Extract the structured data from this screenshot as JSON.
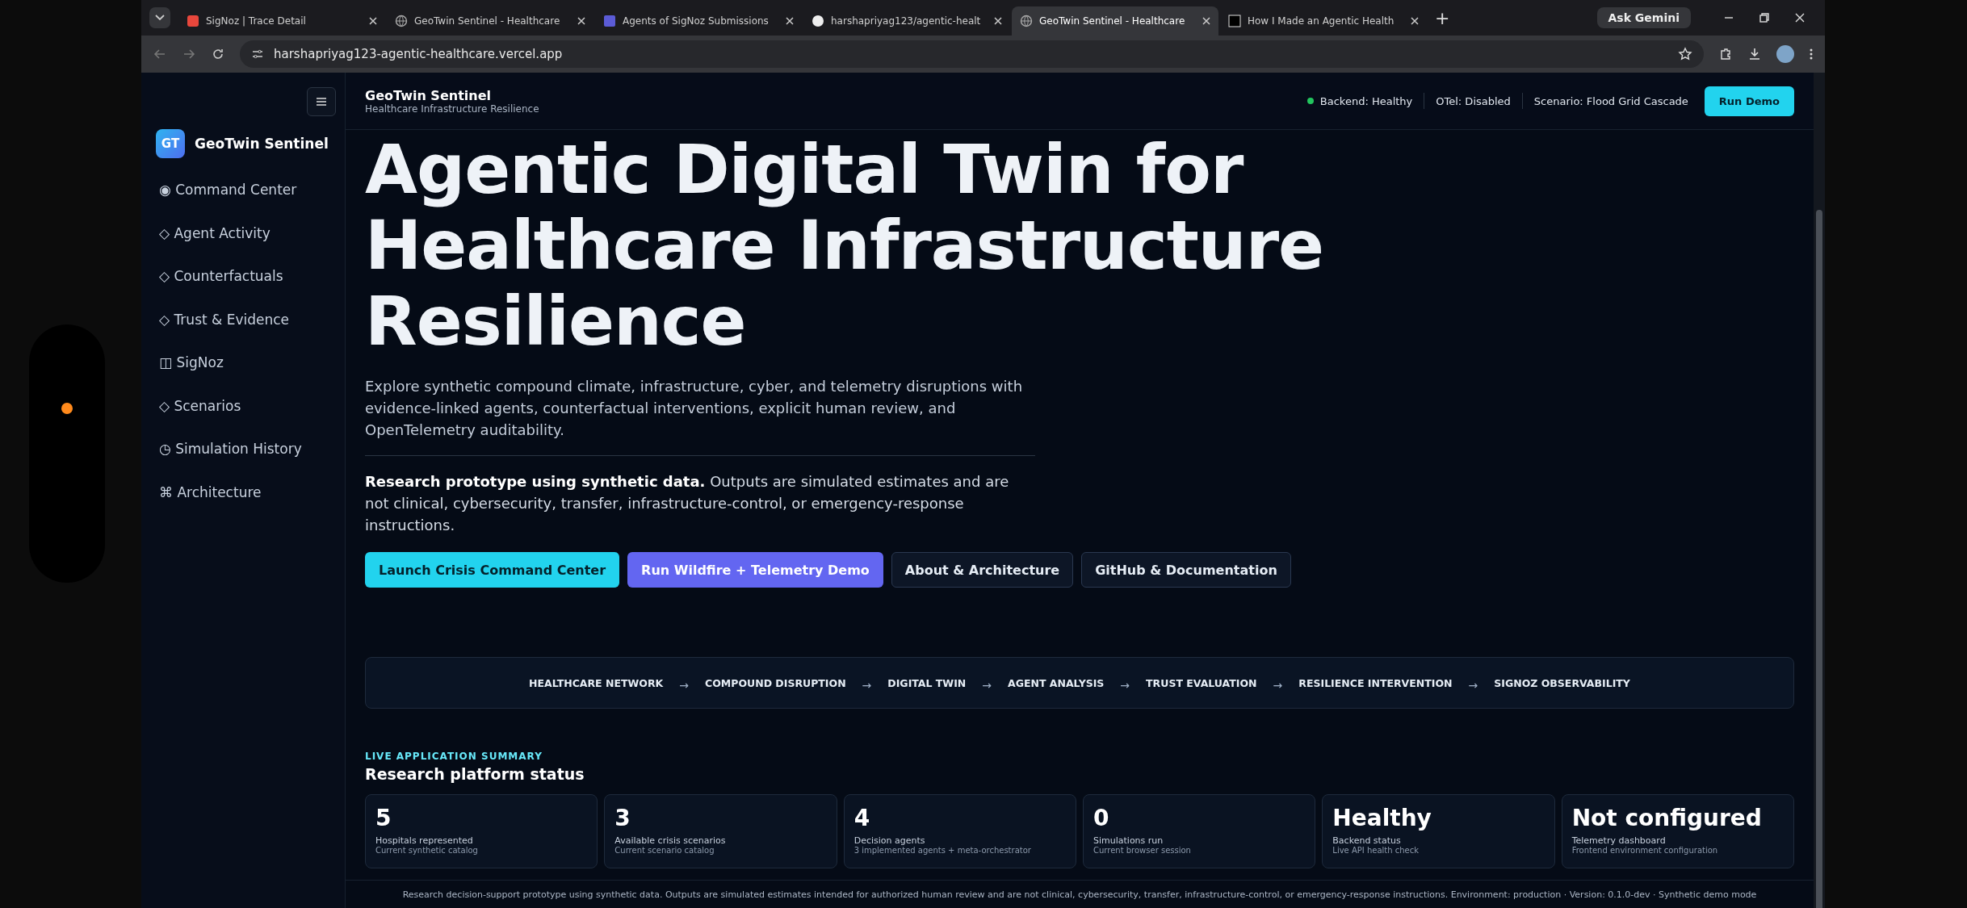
{
  "browser": {
    "tabs": [
      {
        "title": "SigNoz | Trace Detail",
        "selected": false
      },
      {
        "title": "GeoTwin Sentinel - Healthcare",
        "selected": false
      },
      {
        "title": "Agents of SigNoz Submissions",
        "selected": false
      },
      {
        "title": "harshapriyag123/agentic-healt",
        "selected": false
      },
      {
        "title": "GeoTwin Sentinel - Healthcare",
        "selected": true
      },
      {
        "title": "How I Made an Agentic Health",
        "selected": false
      }
    ],
    "new_tab": "+",
    "ask_button": "Ask Gemini",
    "address": "harshapriyag123-agentic-healthcare.vercel.app"
  },
  "sidebar": {
    "logo": "GT",
    "title": "GeoTwin Sentinel",
    "items": [
      {
        "icon": "◉",
        "label": "Command Center"
      },
      {
        "icon": "◇",
        "label": "Agent Activity"
      },
      {
        "icon": "◇",
        "label": "Counterfactuals"
      },
      {
        "icon": "◇",
        "label": "Trust & Evidence"
      },
      {
        "icon": "◫",
        "label": "SigNoz"
      },
      {
        "icon": "◇",
        "label": "Scenarios"
      },
      {
        "icon": "◷",
        "label": "Simulation History"
      },
      {
        "icon": "⌘",
        "label": "Architecture"
      }
    ]
  },
  "header": {
    "title": "GeoTwin Sentinel",
    "subtitle": "Healthcare Infrastructure Resilience",
    "statuses": [
      {
        "label": "Backend: Healthy",
        "color": "#22c55e"
      },
      {
        "label": "OTel: Disabled"
      },
      {
        "label": "Scenario: Flood Grid Cascade"
      }
    ],
    "button": "Run Demo"
  },
  "hero": {
    "title_lines": [
      "Agentic Digital Twin for",
      "Healthcare Infrastructure",
      "Resilience"
    ],
    "intro": "Explore synthetic compound climate, infrastructure, cyber, and telemetry disruptions with evidence-linked agents, counterfactual interventions, explicit human review, and OpenTelemetry auditability.",
    "notice": "**Research prototype using synthetic data.** Outputs are simulated estimates and are not clinical, cybersecurity, transfer, infrastructure-control, or emergency-response instructions.",
    "buttons": [
      {
        "label": "Launch Crisis Command Center",
        "kind": "primary"
      },
      {
        "label": "Run Wildfire + Telemetry Demo",
        "kind": "accent"
      },
      {
        "label": "About & Architecture",
        "kind": "outline"
      },
      {
        "label": "GitHub & Documentation",
        "kind": "outline"
      }
    ]
  },
  "pipeline": {
    "steps": [
      "HEALTHCARE NETWORK",
      "COMPOUND DISRUPTION",
      "DIGITAL TWIN",
      "AGENT ANALYSIS",
      "TRUST EVALUATION",
      "RESILIENCE INTERVENTION",
      "SIGNOZ OBSERVABILITY"
    ],
    "arrow": "→"
  },
  "summary": {
    "eyebrow": "LIVE APPLICATION SUMMARY",
    "heading": "Research platform status",
    "cards": [
      {
        "value": "5",
        "label": "Hospitals represented",
        "sub": "Current synthetic catalog"
      },
      {
        "value": "3",
        "label": "Available crisis scenarios",
        "sub": "Current scenario catalog"
      },
      {
        "value": "4",
        "label": "Decision agents",
        "sub": "3 implemented agents + meta-orchestrator"
      },
      {
        "value": "0",
        "label": "Simulations run",
        "sub": "Current browser session"
      },
      {
        "value": "Healthy",
        "label": "Backend status",
        "sub": "Live API health check"
      },
      {
        "value": "Not configured",
        "label": "Telemetry dashboard",
        "sub": "Frontend environment configuration"
      }
    ]
  },
  "footer": "Research decision-support prototype using synthetic data. Outputs are simulated estimates intended for authorized human review and are not clinical, cybersecurity, transfer, infrastructure-control, or emergency-response instructions. Environment: production · Version: 0.1.0-dev · Synthetic demo mode"
}
